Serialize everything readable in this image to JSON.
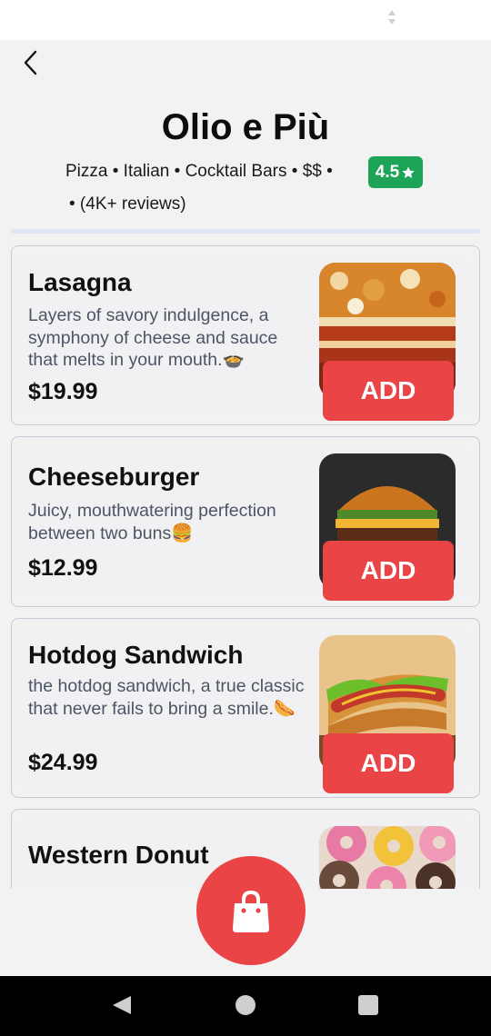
{
  "restaurant": {
    "name": "Olio e Più",
    "meta": "Pizza • Italian • Cocktail Bars • $$ •",
    "rating": "4.5",
    "reviews": "• (4K+ reviews)"
  },
  "menu": {
    "add_label": "ADD",
    "items": [
      {
        "name": "Lasagna",
        "description": "Layers of savory indulgence, a symphony of cheese and sauce that melts in your mouth.🍲",
        "price": "$19.99"
      },
      {
        "name": "Cheeseburger",
        "description": "Juicy, mouthwatering perfection between two buns🍔",
        "price": "$12.99"
      },
      {
        "name": "Hotdog Sandwich",
        "description": "the hotdog sandwich, a true classic that never fails to bring a smile.🌭",
        "price": "$24.99"
      },
      {
        "name": "Western Donut",
        "description": "",
        "price": ""
      }
    ]
  },
  "colors": {
    "accent": "#ea4447",
    "rating_green": "#1ea457"
  },
  "icons": {
    "back": "chevron-left-icon",
    "rating": "star-icon",
    "cart": "shopping-bag-icon"
  }
}
